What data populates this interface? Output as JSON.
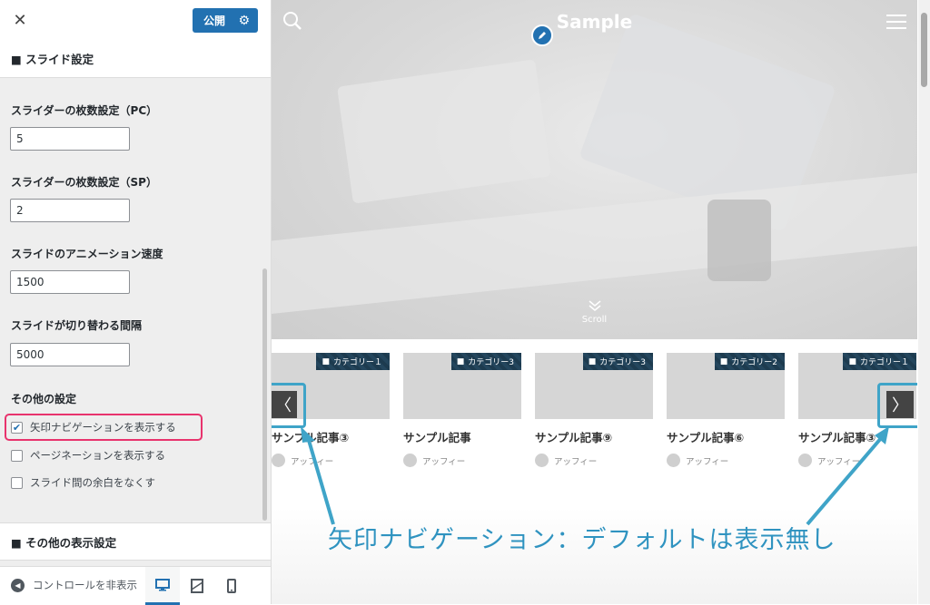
{
  "panel": {
    "close_label": "✕",
    "publish_label": "公開",
    "section_title": "■ スライド設定",
    "fields": [
      {
        "label": "スライダーの枚数設定（PC）",
        "value": "5"
      },
      {
        "label": "スライダーの枚数設定（SP）",
        "value": "2"
      },
      {
        "label": "スライドのアニメーション速度",
        "value": "1500"
      },
      {
        "label": "スライドが切り替わる間隔",
        "value": "5000"
      }
    ],
    "other_settings_label": "その他の設定",
    "checkboxes": [
      {
        "label": "矢印ナビゲーションを表示する",
        "checked": true
      },
      {
        "label": "ページネーションを表示する",
        "checked": false
      },
      {
        "label": "スライド間の余白をなくす",
        "checked": false
      }
    ],
    "next_section_title": "■ その他の表示設定",
    "footer": {
      "hide_controls_label": "コントロールを非表示",
      "devices": [
        "desktop-icon",
        "tablet-icon",
        "mobile-icon"
      ]
    },
    "accent_color": "#2271b1",
    "highlight_color": "#e8336d"
  },
  "preview": {
    "site_title": "Sample",
    "scroll_label": "Scroll",
    "cards": [
      {
        "category": "カテゴリー１",
        "title": "サンプル記事③",
        "author": "アッフィー"
      },
      {
        "category": "カテゴリー3",
        "title": "サンプル記事",
        "author": "アッフィー"
      },
      {
        "category": "カテゴリー3",
        "title": "サンプル記事⑨",
        "author": "アッフィー"
      },
      {
        "category": "カテゴリー2",
        "title": "サンプル記事⑥",
        "author": "アッフィー"
      },
      {
        "category": "カテゴリー１",
        "title": "サンプル記事③",
        "author": "アッフィー"
      }
    ],
    "prev_arrow": "〈",
    "next_arrow": "〉",
    "annotation": "矢印ナビゲーション：デフォルトは表示無し",
    "annotation_color": "#2f93c0"
  }
}
